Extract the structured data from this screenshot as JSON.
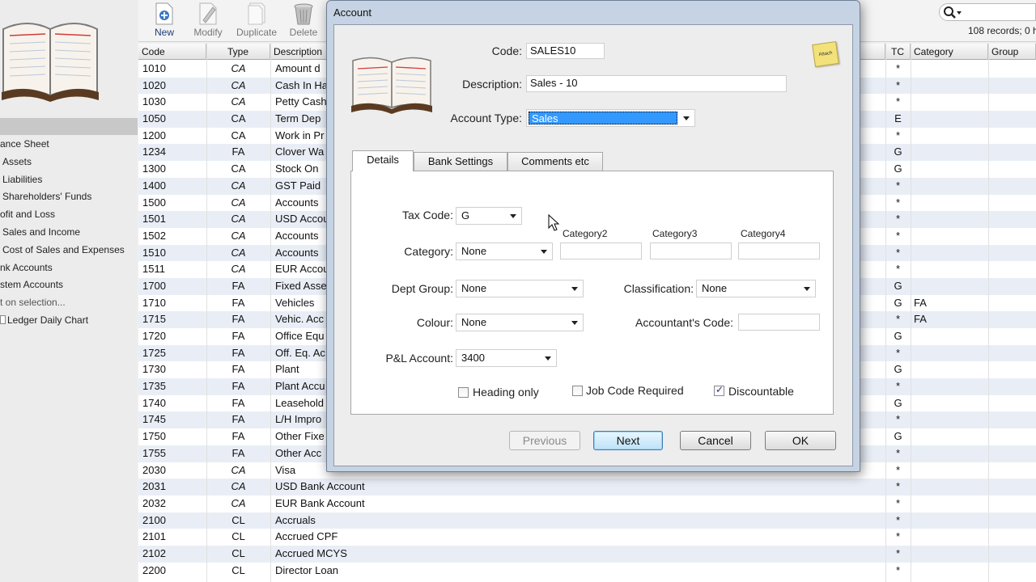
{
  "sidebar": {
    "items": [
      "ance Sheet",
      "Assets",
      "Liabilities",
      "Shareholders' Funds",
      "ofit and Loss",
      "Sales and Income",
      "Cost of Sales and Expenses",
      "nk Accounts",
      "stem Accounts",
      "t on selection...",
      "Ledger Daily Chart"
    ]
  },
  "toolbar": {
    "new_label": "New",
    "modify_label": "Modify",
    "duplicate_label": "Duplicate",
    "delete_label": "Delete",
    "record_info": "108 records; 0 h"
  },
  "grid": {
    "headers": {
      "code": "Code",
      "type": "Type",
      "description": "Description",
      "tc": "TC",
      "category": "Category",
      "group": "Group"
    },
    "rows": [
      {
        "code": "1010",
        "type": "CA",
        "italic": true,
        "desc": "Amount d",
        "tc": "*",
        "cat": ""
      },
      {
        "code": "1020",
        "type": "CA",
        "italic": true,
        "desc": "Cash In Ha",
        "tc": "*",
        "cat": ""
      },
      {
        "code": "1030",
        "type": "CA",
        "italic": true,
        "desc": "Petty Cash",
        "tc": "*",
        "cat": ""
      },
      {
        "code": "1050",
        "type": "CA",
        "italic": false,
        "desc": "Term Dep",
        "tc": "E",
        "cat": ""
      },
      {
        "code": "1200",
        "type": "CA",
        "italic": false,
        "desc": "Work in Pr",
        "tc": "*",
        "cat": ""
      },
      {
        "code": "1234",
        "type": "FA",
        "italic": false,
        "desc": "Clover Wa",
        "tc": "G",
        "cat": ""
      },
      {
        "code": "1300",
        "type": "CA",
        "italic": false,
        "desc": "Stock On",
        "tc": "G",
        "cat": ""
      },
      {
        "code": "1400",
        "type": "CA",
        "italic": true,
        "desc": "GST Paid",
        "tc": "*",
        "cat": ""
      },
      {
        "code": "1500",
        "type": "CA",
        "italic": true,
        "desc": "Accounts",
        "tc": "*",
        "cat": ""
      },
      {
        "code": "1501",
        "type": "CA",
        "italic": true,
        "desc": "USD Accou",
        "tc": "*",
        "cat": ""
      },
      {
        "code": "1502",
        "type": "CA",
        "italic": true,
        "desc": "Accounts",
        "tc": "*",
        "cat": ""
      },
      {
        "code": "1510",
        "type": "CA",
        "italic": true,
        "desc": "Accounts",
        "tc": "*",
        "cat": ""
      },
      {
        "code": "1511",
        "type": "CA",
        "italic": true,
        "desc": "EUR Accou",
        "tc": "*",
        "cat": ""
      },
      {
        "code": "1700",
        "type": "FA",
        "italic": false,
        "desc": "Fixed Asse",
        "tc": "G",
        "cat": ""
      },
      {
        "code": "1710",
        "type": "FA",
        "italic": false,
        "desc": "Vehicles",
        "tc": "G",
        "cat": "FA"
      },
      {
        "code": "1715",
        "type": "FA",
        "italic": false,
        "desc": "Vehic. Acc",
        "tc": "*",
        "cat": "FA"
      },
      {
        "code": "1720",
        "type": "FA",
        "italic": false,
        "desc": "Office Equ",
        "tc": "G",
        "cat": ""
      },
      {
        "code": "1725",
        "type": "FA",
        "italic": false,
        "desc": "Off. Eq. Ac",
        "tc": "*",
        "cat": ""
      },
      {
        "code": "1730",
        "type": "FA",
        "italic": false,
        "desc": "Plant",
        "tc": "G",
        "cat": ""
      },
      {
        "code": "1735",
        "type": "FA",
        "italic": false,
        "desc": "Plant Accu",
        "tc": "*",
        "cat": ""
      },
      {
        "code": "1740",
        "type": "FA",
        "italic": false,
        "desc": "Leasehold",
        "tc": "G",
        "cat": ""
      },
      {
        "code": "1745",
        "type": "FA",
        "italic": false,
        "desc": "L/H Impro",
        "tc": "*",
        "cat": ""
      },
      {
        "code": "1750",
        "type": "FA",
        "italic": false,
        "desc": "Other Fixe",
        "tc": "G",
        "cat": ""
      },
      {
        "code": "1755",
        "type": "FA",
        "italic": false,
        "desc": "Other Acc",
        "tc": "*",
        "cat": ""
      },
      {
        "code": "2030",
        "type": "CA",
        "italic": true,
        "desc": "Visa",
        "tc": "*",
        "cat": ""
      },
      {
        "code": "2031",
        "type": "CA",
        "italic": true,
        "desc": "USD Bank Account",
        "tc": "*",
        "cat": ""
      },
      {
        "code": "2032",
        "type": "CA",
        "italic": true,
        "desc": "EUR Bank Account",
        "tc": "*",
        "cat": ""
      },
      {
        "code": "2100",
        "type": "CL",
        "italic": false,
        "desc": "Accruals",
        "tc": "*",
        "cat": ""
      },
      {
        "code": "2101",
        "type": "CL",
        "italic": false,
        "desc": "Accrued CPF",
        "tc": "*",
        "cat": ""
      },
      {
        "code": "2102",
        "type": "CL",
        "italic": false,
        "desc": "Accrued MCYS",
        "tc": "*",
        "cat": ""
      },
      {
        "code": "2200",
        "type": "CL",
        "italic": false,
        "desc": "Director Loan",
        "tc": "*",
        "cat": ""
      }
    ]
  },
  "dialog": {
    "title": "Account",
    "code_label": "Code:",
    "code_value": "SALES10",
    "description_label": "Description:",
    "description_value": "Sales - 10",
    "account_type_label": "Account Type:",
    "account_type_value": "Sales",
    "note_text": "Attach",
    "tabs": [
      "Details",
      "Bank Settings",
      "Comments etc"
    ],
    "tax_code_label": "Tax Code:",
    "tax_code_value": "G",
    "category_label": "Category:",
    "category_value": "None",
    "category2_label": "Category2",
    "category3_label": "Category3",
    "category4_label": "Category4",
    "dept_group_label": "Dept Group:",
    "dept_group_value": "None",
    "classification_label": "Classification:",
    "classification_value": "None",
    "colour_label": "Colour:",
    "colour_value": "None",
    "accountants_code_label": "Accountant's Code:",
    "pl_account_label": "P&L Account:",
    "pl_account_value": "3400",
    "heading_only_label": "Heading only",
    "heading_only_checked": false,
    "job_code_label": "Job Code Required",
    "job_code_checked": false,
    "discountable_label": "Discountable",
    "discountable_checked": true,
    "buttons": {
      "previous": "Previous",
      "next": "Next",
      "cancel": "Cancel",
      "ok": "OK"
    }
  },
  "colors": {
    "selection": "#3399ff",
    "row_alt": "#e9eef6",
    "dialog_frame": "#c5d3e4"
  }
}
